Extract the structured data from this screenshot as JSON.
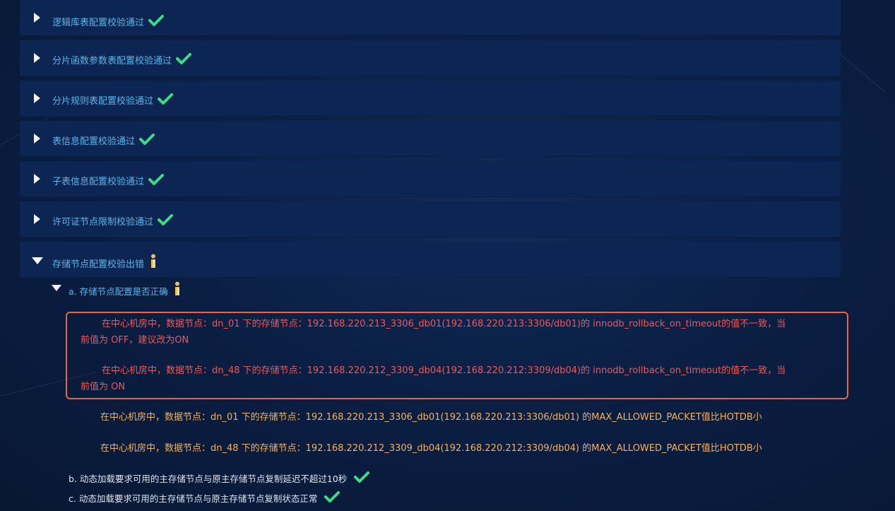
{
  "check_rows": [
    {
      "label": "逻辑库表配置校验通过",
      "status_icon": "check-icon"
    },
    {
      "label": "分片函数参数表配置校验通过",
      "status_icon": "check-icon"
    },
    {
      "label": "分片规则表配置校验通过",
      "status_icon": "check-icon"
    },
    {
      "label": "表信息配置校验通过",
      "status_icon": "check-icon"
    },
    {
      "label": "子表信息配置校验通过",
      "status_icon": "check-icon"
    },
    {
      "label": "许可证节点限制校验通过",
      "status_icon": "check-icon"
    },
    {
      "label": "存储节点配置校验出错",
      "status_icon": "info-icon"
    }
  ],
  "sub_a": {
    "label": "a. 存储节点配置是否正确",
    "status_icon": "info-icon"
  },
  "errors": [
    {
      "line1": "在中心机房中，数据节点：dn_01 下的存储节点：192.168.220.213_3306_db01(192.168.220.213:3306/db01)的 innodb_rollback_on_timeout的值不一致，当",
      "line2": "前值为 OFF，建议改为ON"
    },
    {
      "line1": "在中心机房中，数据节点：dn_48 下的存储节点：192.168.220.212_3309_db04(192.168.220.212:3309/db04)的 innodb_rollback_on_timeout的值不一致，当",
      "line2": "前值为 ON"
    }
  ],
  "warnings": [
    "在中心机房中，数据节点：dn_01 下的存储节点：192.168.220.213_3306_db01(192.168.220.213:3306/db01) 的MAX_ALLOWED_PACKET值比HOTDB小",
    "在中心机房中，数据节点：dn_48 下的存储节点：192.168.220.212_3309_db04(192.168.220.212:3309/db04) 的MAX_ALLOWED_PACKET值比HOTDB小"
  ],
  "sub_b": {
    "label": "b. 动态加载要求可用的主存储节点与原主存储节点复制延迟不超过10秒",
    "status_icon": "check-icon"
  },
  "sub_c": {
    "label": "c. 动态加载要求可用的主存储节点与原主存储节点复制状态正常",
    "status_icon": "check-icon"
  },
  "colors": {
    "ok": "#3ddc84",
    "info": "#f0c060",
    "error": "#f25757",
    "warning": "#f5b25a",
    "highlight_border": "#e8663a",
    "label": "#56b6ec"
  }
}
